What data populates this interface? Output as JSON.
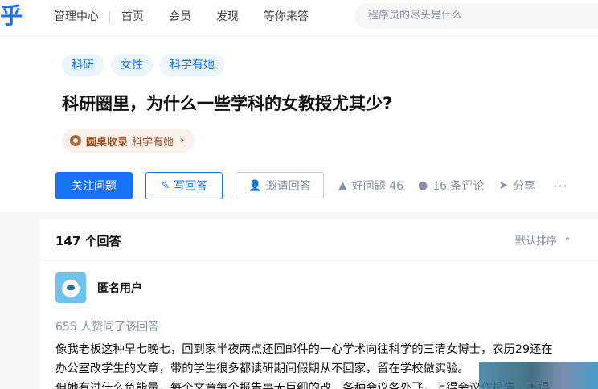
{
  "header": {
    "logo": "乎",
    "nav": [
      "管理中心",
      "首页",
      "会员",
      "发现",
      "等你来答"
    ],
    "search_placeholder": "程序员的尽头是什么"
  },
  "question": {
    "topics": [
      "科研",
      "女性",
      "科学有她"
    ],
    "title": "科研圈里，为什么一些学科的女教授尤其少?",
    "collection": {
      "label": "圆桌收录",
      "name": "科学有她"
    },
    "actions": {
      "follow": "关注问题",
      "write": "写回答",
      "invite": "邀请回答",
      "good_question": "好问题 46",
      "comments": "16 条评论",
      "share": "分享",
      "more": "···"
    }
  },
  "answers": {
    "count": "147 个回答",
    "sort": "默认排序",
    "first": {
      "author": "匿名用户",
      "votes": "655 人赞同了该回答",
      "lines": [
        "像我老板这种早七晚七，回到家半夜两点还回邮件的一心学术向往科学的三清女博士，农历29还在",
        "办公室改学生的文章，带的学生很多都读研期间假期从不回家，留在学校做实验。",
        "但她有过什么负能量，每个文章每个报告事无巨细的改，各种会议各处飞，上得会议作报告，下得"
      ]
    }
  },
  "icons": {
    "write": "pencil-icon",
    "invite": "user-plus-icon",
    "good_question": "thumb-up-icon",
    "comments": "comment-icon",
    "share": "share-icon",
    "sort": "sort-icon",
    "collection": "roundtable-icon"
  },
  "colors": {
    "brand": "#1772f6",
    "muted": "#8590a6",
    "collect": "#a3542a"
  }
}
